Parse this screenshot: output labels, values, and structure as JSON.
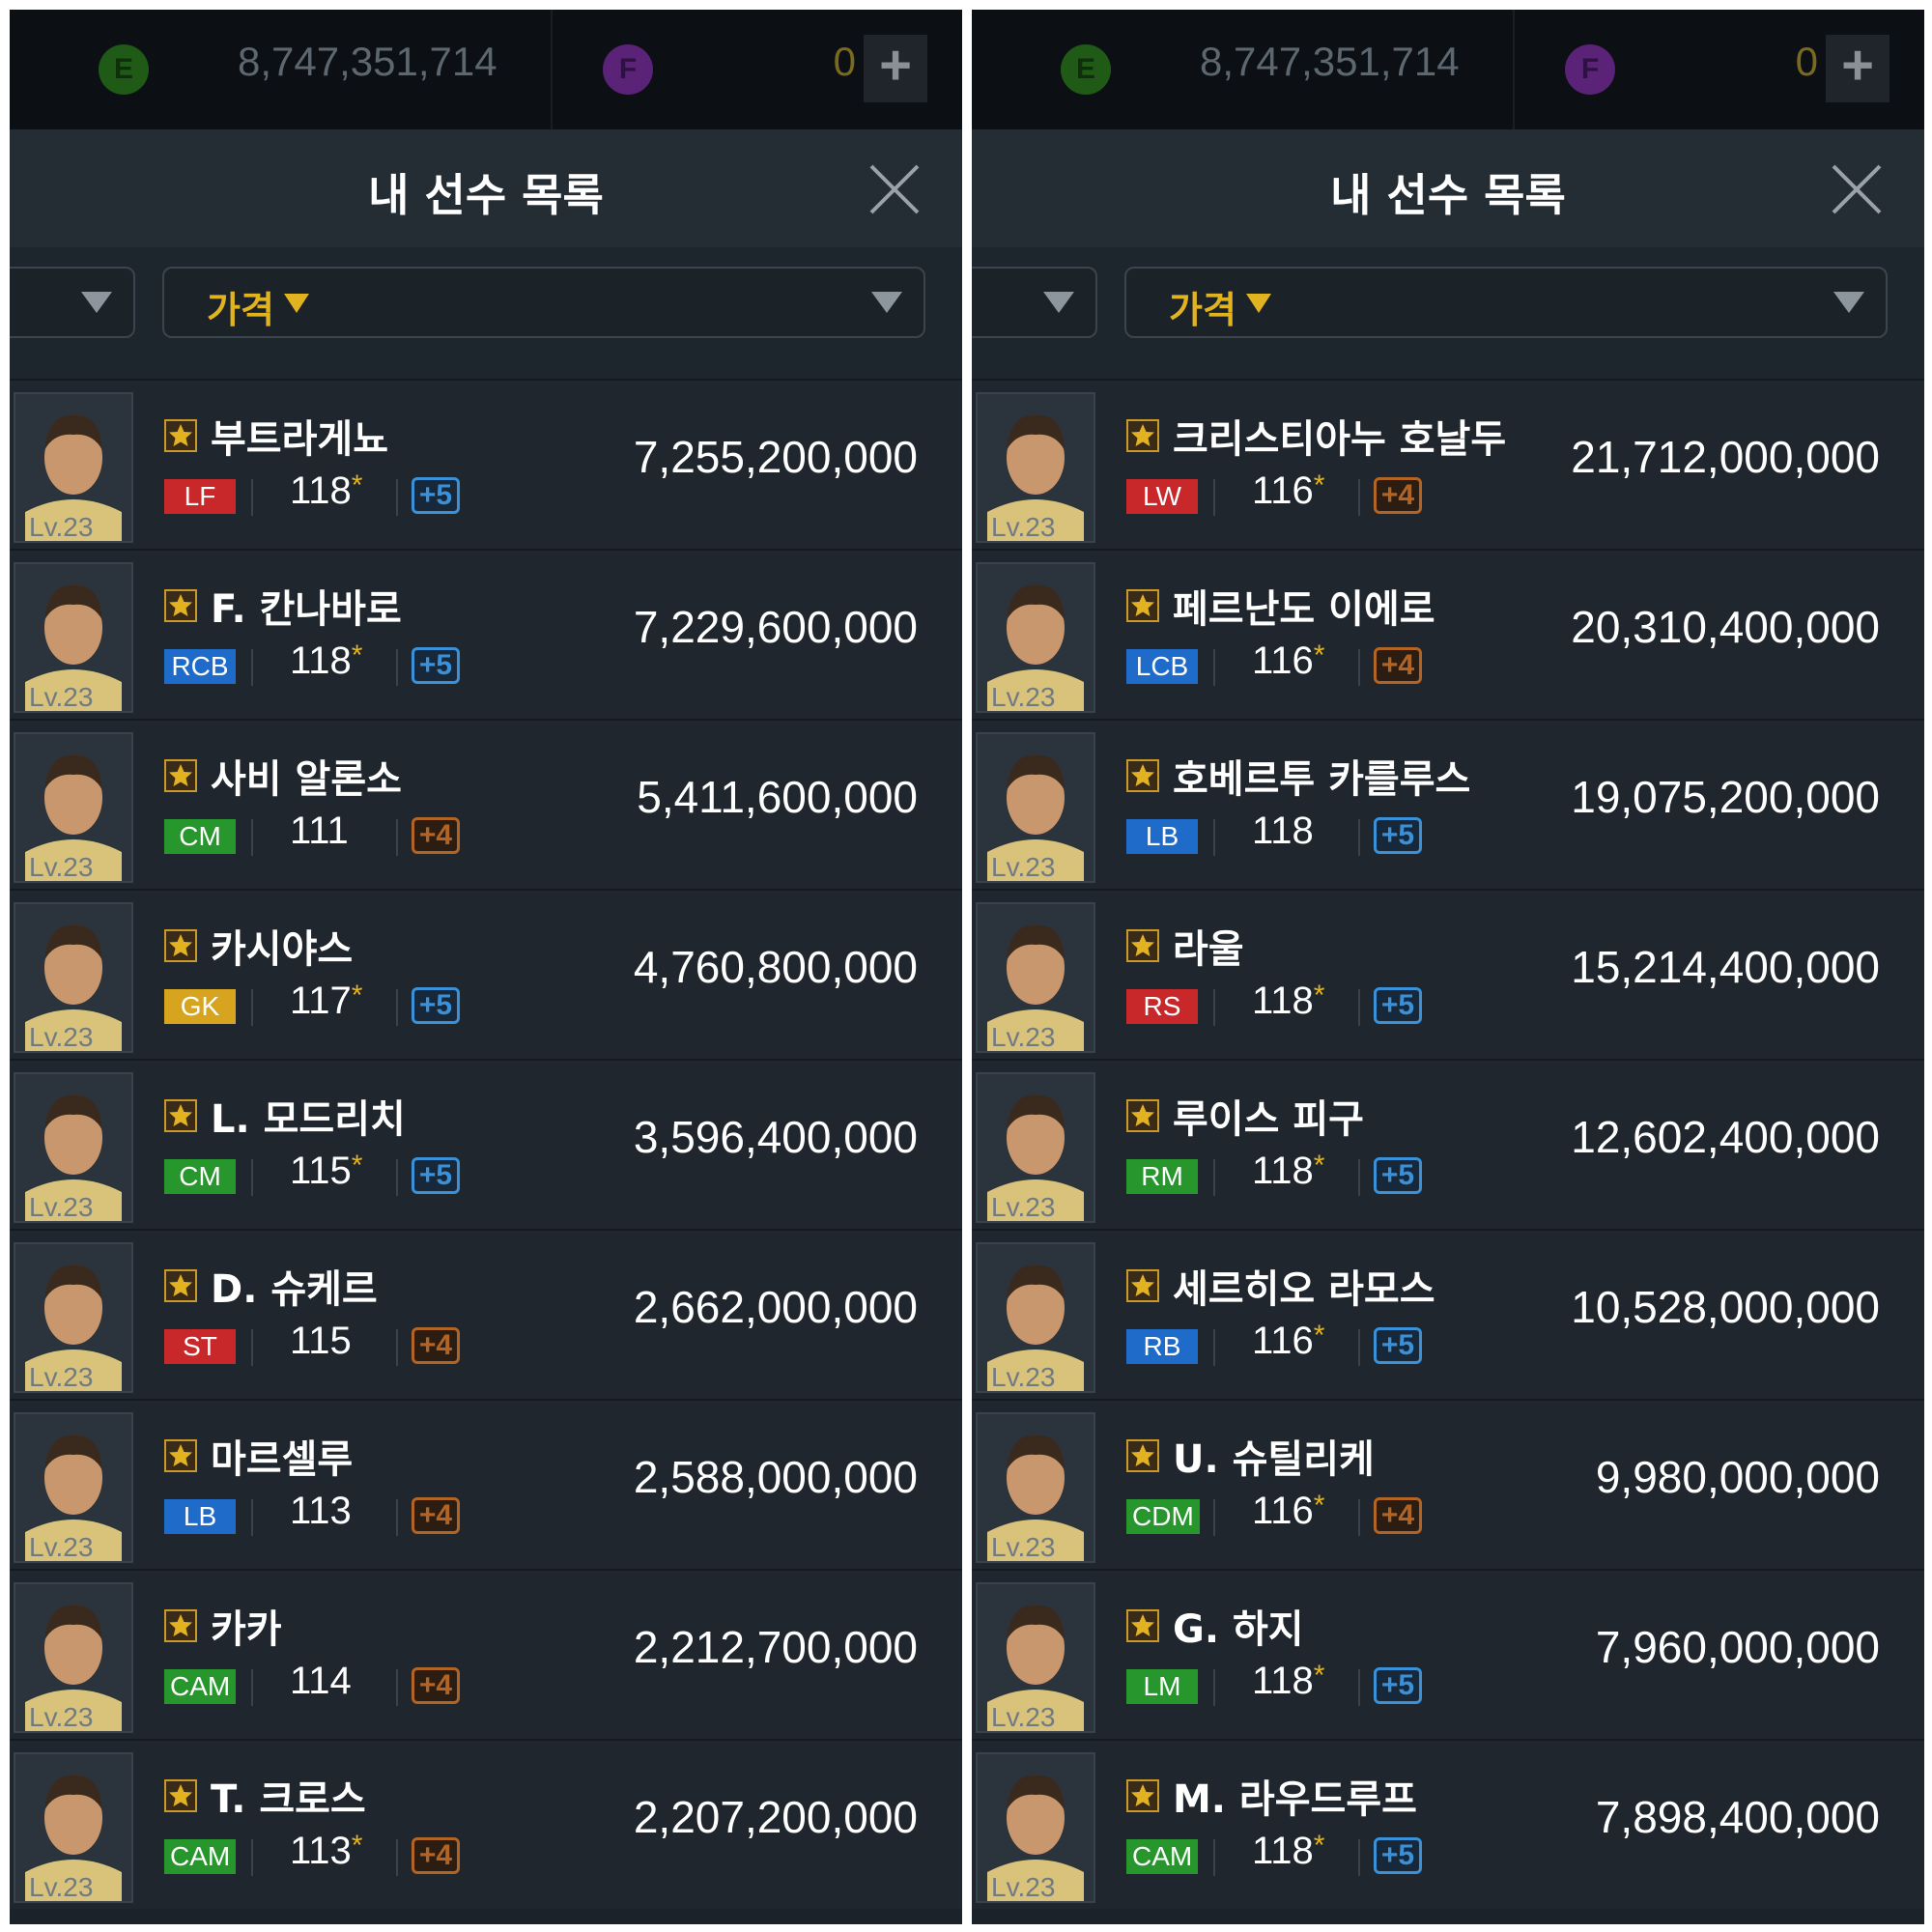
{
  "colors": {
    "panel_bg": "#1b2229",
    "row_bg": "#1f262d",
    "accent_gold": "#e2b321",
    "badge_blue": "#3b90d8",
    "badge_orange": "#b26425",
    "pos_red": "#c8282a",
    "pos_blue": "#1f6bc9",
    "pos_green": "#27962c",
    "pos_yellow": "#d7a41f"
  },
  "panels": [
    {
      "header": {
        "currency_e_icon": "E",
        "currency_e_value": "8,747,351,714",
        "currency_f_icon": "F",
        "currency_f_value": "0",
        "plus_label": "+"
      },
      "title": "내 선수 목록",
      "close_icon": "close-icon",
      "filter": {
        "sort_label": "가격"
      },
      "players": [
        {
          "name": "부트라게뇨",
          "level": "Lv.23",
          "position": "LF",
          "pos_color": "red",
          "ovr": "118",
          "ovr_star": "*",
          "badge": "+5",
          "badge_type": "5",
          "price": "7,255,200,000"
        },
        {
          "name": "F. 칸나바로",
          "level": "Lv.23",
          "position": "RCB",
          "pos_color": "blue",
          "ovr": "118",
          "ovr_star": "*",
          "badge": "+5",
          "badge_type": "5",
          "price": "7,229,600,000"
        },
        {
          "name": "사비 알론소",
          "level": "Lv.23",
          "position": "CM",
          "pos_color": "green",
          "ovr": "111",
          "ovr_star": "",
          "badge": "+4",
          "badge_type": "4",
          "price": "5,411,600,000"
        },
        {
          "name": "카시야스",
          "level": "Lv.23",
          "position": "GK",
          "pos_color": "yellow",
          "ovr": "117",
          "ovr_star": "*",
          "badge": "+5",
          "badge_type": "5",
          "price": "4,760,800,000"
        },
        {
          "name": "L. 모드리치",
          "level": "Lv.23",
          "position": "CM",
          "pos_color": "green",
          "ovr": "115",
          "ovr_star": "*",
          "badge": "+5",
          "badge_type": "5",
          "price": "3,596,400,000"
        },
        {
          "name": "D. 슈케르",
          "level": "Lv.23",
          "position": "ST",
          "pos_color": "red",
          "ovr": "115",
          "ovr_star": "",
          "badge": "+4",
          "badge_type": "4",
          "price": "2,662,000,000"
        },
        {
          "name": "마르셀루",
          "level": "Lv.23",
          "position": "LB",
          "pos_color": "blue",
          "ovr": "113",
          "ovr_star": "",
          "badge": "+4",
          "badge_type": "4",
          "price": "2,588,000,000"
        },
        {
          "name": "카카",
          "level": "Lv.23",
          "position": "CAM",
          "pos_color": "green",
          "ovr": "114",
          "ovr_star": "",
          "badge": "+4",
          "badge_type": "4",
          "price": "2,212,700,000"
        },
        {
          "name": "T. 크로스",
          "level": "Lv.23",
          "position": "CAM",
          "pos_color": "green",
          "ovr": "113",
          "ovr_star": "*",
          "badge": "+4",
          "badge_type": "4",
          "price": "2,207,200,000"
        }
      ]
    },
    {
      "header": {
        "currency_e_icon": "E",
        "currency_e_value": "8,747,351,714",
        "currency_f_icon": "F",
        "currency_f_value": "0",
        "plus_label": "+"
      },
      "title": "내 선수 목록",
      "close_icon": "close-icon",
      "filter": {
        "sort_label": "가격"
      },
      "players": [
        {
          "name": "크리스티아누 호날두",
          "level": "Lv.23",
          "position": "LW",
          "pos_color": "red",
          "ovr": "116",
          "ovr_star": "*",
          "badge": "+4",
          "badge_type": "4",
          "price": "21,712,000,000"
        },
        {
          "name": "페르난도 이에로",
          "level": "Lv.23",
          "position": "LCB",
          "pos_color": "blue",
          "ovr": "116",
          "ovr_star": "*",
          "badge": "+4",
          "badge_type": "4",
          "price": "20,310,400,000"
        },
        {
          "name": "호베르투 카를루스",
          "level": "Lv.23",
          "position": "LB",
          "pos_color": "blue",
          "ovr": "118",
          "ovr_star": "",
          "badge": "+5",
          "badge_type": "5",
          "price": "19,075,200,000"
        },
        {
          "name": "라울",
          "level": "Lv.23",
          "position": "RS",
          "pos_color": "red",
          "ovr": "118",
          "ovr_star": "*",
          "badge": "+5",
          "badge_type": "5",
          "price": "15,214,400,000"
        },
        {
          "name": "루이스 피구",
          "level": "Lv.23",
          "position": "RM",
          "pos_color": "green",
          "ovr": "118",
          "ovr_star": "*",
          "badge": "+5",
          "badge_type": "5",
          "price": "12,602,400,000"
        },
        {
          "name": "세르히오 라모스",
          "level": "Lv.23",
          "position": "RB",
          "pos_color": "blue",
          "ovr": "116",
          "ovr_star": "*",
          "badge": "+5",
          "badge_type": "5",
          "price": "10,528,000,000"
        },
        {
          "name": "U. 슈틸리케",
          "level": "Lv.23",
          "position": "CDM",
          "pos_color": "green",
          "ovr": "116",
          "ovr_star": "*",
          "badge": "+4",
          "badge_type": "4",
          "price": "9,980,000,000"
        },
        {
          "name": "G. 하지",
          "level": "Lv.23",
          "position": "LM",
          "pos_color": "green",
          "ovr": "118",
          "ovr_star": "*",
          "badge": "+5",
          "badge_type": "5",
          "price": "7,960,000,000"
        },
        {
          "name": "M. 라우드루프",
          "level": "Lv.23",
          "position": "CAM",
          "pos_color": "green",
          "ovr": "118",
          "ovr_star": "*",
          "badge": "+5",
          "badge_type": "5",
          "price": "7,898,400,000"
        }
      ]
    }
  ]
}
